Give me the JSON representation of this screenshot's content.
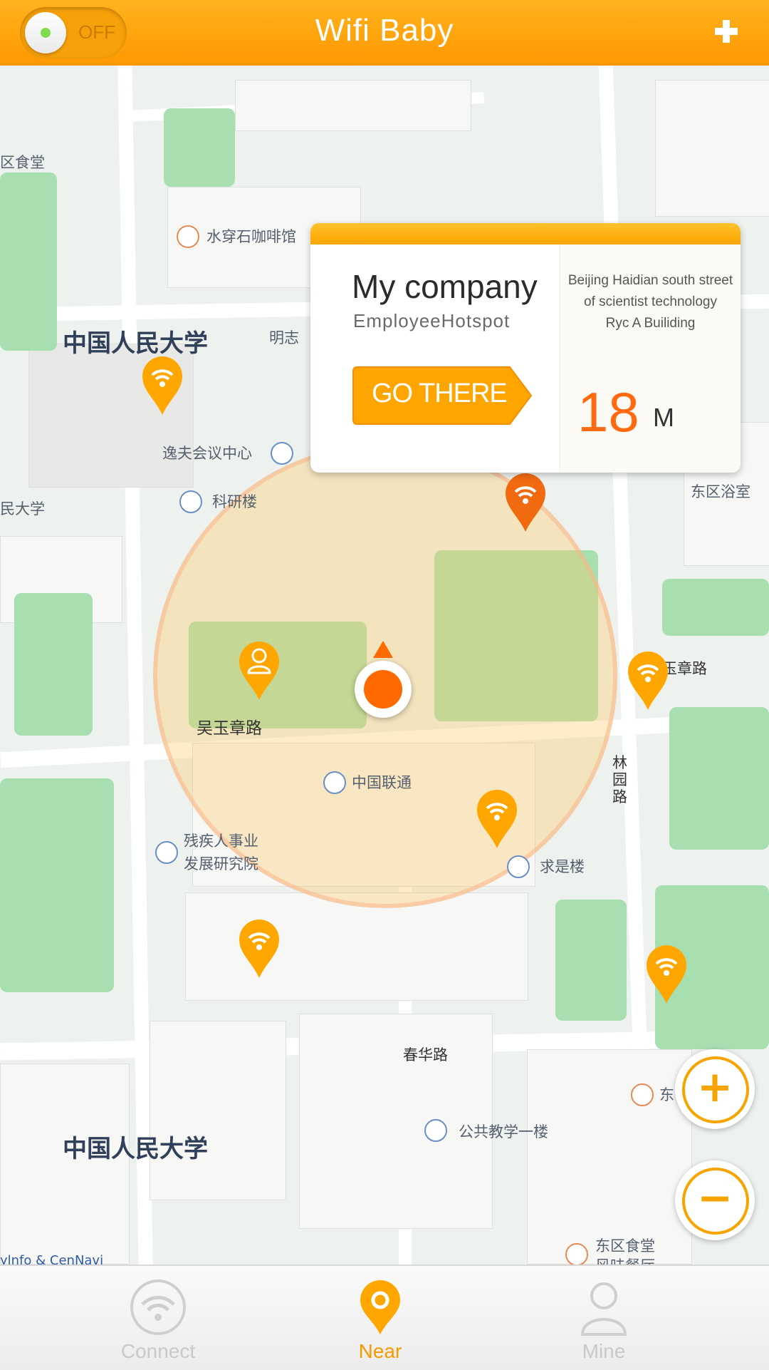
{
  "header": {
    "title": "Wifi Baby",
    "toggle_label": "OFF"
  },
  "card": {
    "name": "My company",
    "subtitle": "EmployeeHotspot",
    "button_label": "GO THERE",
    "address_lines": [
      "Beijing Haidian south street",
      "of scientist technology",
      "Ryc A Builiding"
    ],
    "distance": "18",
    "unit": "M"
  },
  "map": {
    "labels": {
      "canteen_left": "区食堂",
      "coffee": "水穿石咖啡馆",
      "univ_top": "中国人民大学",
      "mingzhi": "明志",
      "yifu": "逸夫会议中心",
      "keyan": "科研楼",
      "univ_left": "民大学",
      "wuyu": "吴玉章路",
      "liantong": "中国联通",
      "cancan1": "残疾人事业",
      "cancan2": "发展研究院",
      "qiushi": "求是楼",
      "bath": "东区浴室",
      "zhang_road": "玉章路",
      "linyuan": "林园路",
      "chunhua": "春华路",
      "univ_bottom": "中国人民大学",
      "teaching": "公共教学一楼",
      "east_canteen": "东区食堂",
      "east_small": "东",
      "flavor": "风味餐厅",
      "attribution": "ylnfo & CenNavi"
    }
  },
  "zoom": {
    "in": "+",
    "out": "−"
  },
  "tabs": [
    {
      "label": "Connect"
    },
    {
      "label": "Near"
    },
    {
      "label": "Mine"
    }
  ],
  "colors": {
    "accent": "#ff9f0f",
    "distance": "#ff6a10",
    "tab_active": "#f79a00",
    "tab_inactive": "#c9c9c9"
  }
}
